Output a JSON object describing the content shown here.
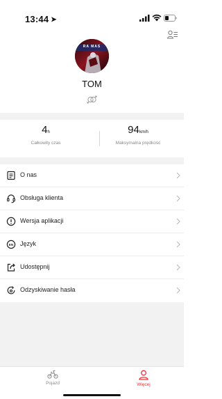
{
  "status_bar": {
    "time": "13:44",
    "icons": [
      "location-arrow-icon",
      "cellular-signal-icon",
      "wifi-icon",
      "battery-icon"
    ]
  },
  "profile": {
    "name": "TOM",
    "avatar_caption": "RA MAS",
    "top_right_icon": "id-card-icon",
    "gender_icon": "gender-symbol-icon"
  },
  "stats": [
    {
      "value": "4",
      "unit": "h",
      "label": "Całkowity czas"
    },
    {
      "value": "94",
      "unit": "km/h",
      "label": "Maksymalna prędkość"
    }
  ],
  "menu": [
    {
      "label": "O nas",
      "icon": "document-icon"
    },
    {
      "label": "Obsługa klienta",
      "icon": "headset-icon"
    },
    {
      "label": "Wersja aplikacji",
      "icon": "info-circle-icon"
    },
    {
      "label": "Język",
      "icon": "language-en-icon"
    },
    {
      "label": "Udostępnij",
      "icon": "share-icon"
    },
    {
      "label": "Odzyskiwanie hasła",
      "icon": "password-reset-icon"
    }
  ],
  "tabs": [
    {
      "label": "Pojazd",
      "icon": "scooter-icon",
      "active": false
    },
    {
      "label": "Więcej",
      "icon": "person-icon",
      "active": true
    }
  ],
  "colors": {
    "accent": "#e8303a",
    "inactive": "#8a8a8a",
    "background": "#f2f2f3"
  }
}
